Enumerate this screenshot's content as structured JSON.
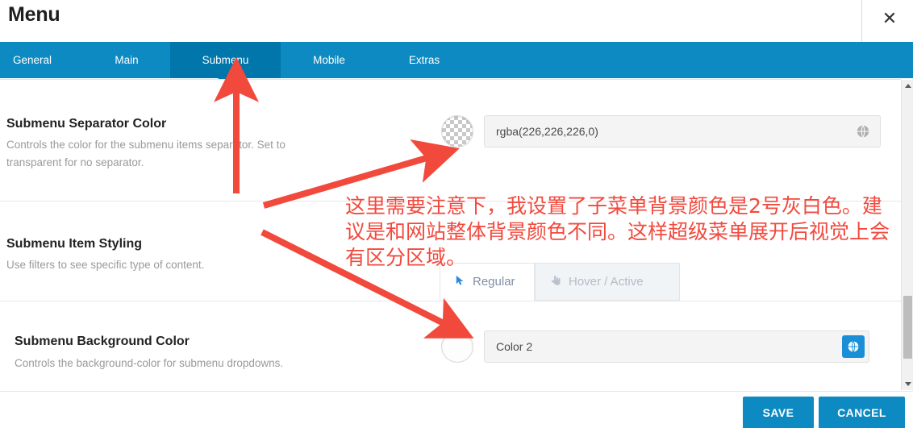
{
  "header": {
    "title": "Menu",
    "close_label": "✕"
  },
  "tabs": [
    {
      "label": "General",
      "active": false
    },
    {
      "label": "Main",
      "active": false
    },
    {
      "label": "Submenu",
      "active": true
    },
    {
      "label": "Mobile",
      "active": false
    },
    {
      "label": "Extras",
      "active": false
    }
  ],
  "rows": [
    {
      "label": "Submenu Separator Color",
      "desc": "Controls the color for the submenu items separator. Set to transparent for no separator.",
      "swatch": "transparent-checker-swatch",
      "value": "rgba(226,226,226,0)",
      "icon": "globe-icon"
    },
    {
      "label": "Submenu Item Styling",
      "desc": "Use filters to see specific type of content."
    },
    {
      "label": "Submenu Background Color",
      "desc": "Controls the background-color for submenu dropdowns.",
      "swatch": "white-swatch",
      "value": "Color 2",
      "icon": "globe-icon"
    }
  ],
  "subtabs": [
    {
      "label": "Regular",
      "icon": "cursor-arrow-icon",
      "active": true
    },
    {
      "label": "Hover / Active",
      "icon": "pointing-hand-icon",
      "active": false
    }
  ],
  "footer": {
    "save_label": "SAVE",
    "cancel_label": "CANCEL"
  },
  "annotation": {
    "text": "这里需要注意下，我设置了子菜单背景颜色是2号灰白色。建议是和网站整体背景颜色不同。这样超级菜单展开后视觉上会有区分区域。",
    "color": "#f2493d"
  },
  "colors": {
    "tabbar": "#0e8ac2",
    "tab_active": "#0076ab",
    "button": "#0e8ac2",
    "annotation": "#f2493d",
    "field_bg": "#f4f4f4",
    "globe_button": "#1a8fd8"
  },
  "scrollbar": {
    "up_icon": "triangle-up-icon",
    "down_icon": "triangle-down-icon"
  }
}
